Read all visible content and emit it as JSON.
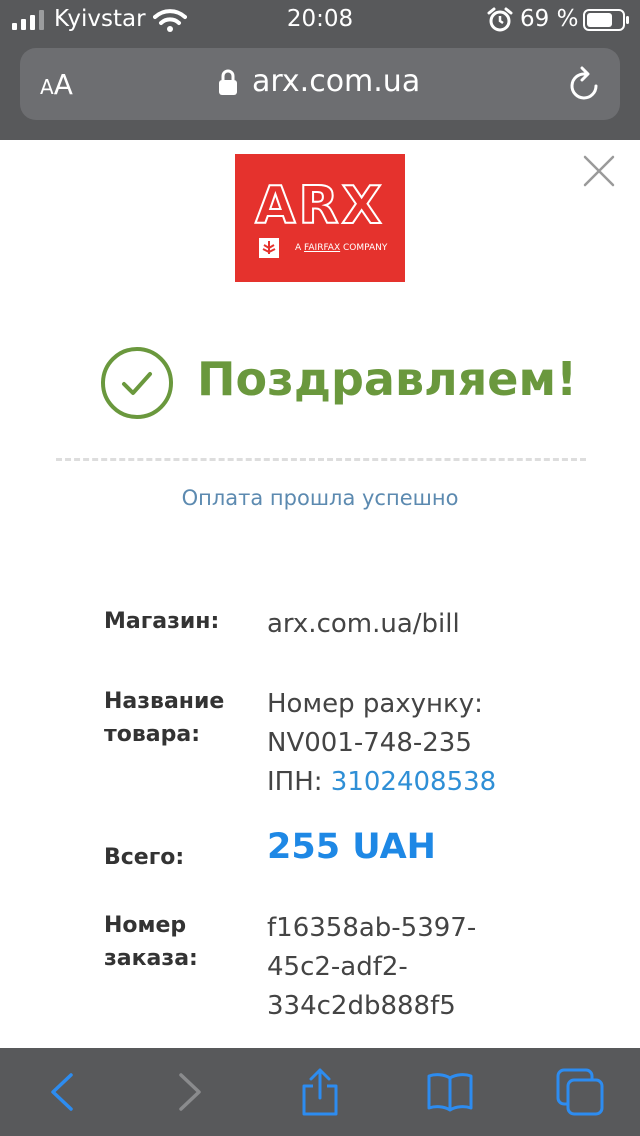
{
  "status_bar": {
    "carrier": "Kyivstar",
    "time": "20:08",
    "battery_percent": "69 %"
  },
  "address_bar": {
    "text_size_small": "A",
    "text_size_large": "A",
    "url": "arx.com.ua"
  },
  "logo": {
    "title": "ARX",
    "subtitle_prefix": "A ",
    "subtitle_brand": "FAIRFAX",
    "subtitle_suffix": " COMPANY",
    "brand_color": "#e5322d"
  },
  "result": {
    "headline": "Поздравляем!",
    "message": "Оплата прошла успешно",
    "accent_color": "#6a983d"
  },
  "details": {
    "shop_label": "Магазин:",
    "shop_value": "arx.com.ua/bill",
    "product_label_line1": "Название",
    "product_label_line2": "товара:",
    "product_line1": "Номер рахунку:",
    "product_line2": "NV001-748-235",
    "product_line3_prefix": "ІПН: ",
    "product_line3_link": "3102408538",
    "total_label": "Всего:",
    "total_value": "255 UAH",
    "order_label_line1": "Номер",
    "order_label_line2": "заказа:",
    "order_line1": "f16358ab-5397-",
    "order_line2": "45c2-adf2-",
    "order_line3": "334c2db888f5"
  },
  "toolbar": {
    "icons": [
      "back-icon",
      "forward-icon",
      "share-icon",
      "bookmarks-icon",
      "tabs-icon"
    ]
  }
}
